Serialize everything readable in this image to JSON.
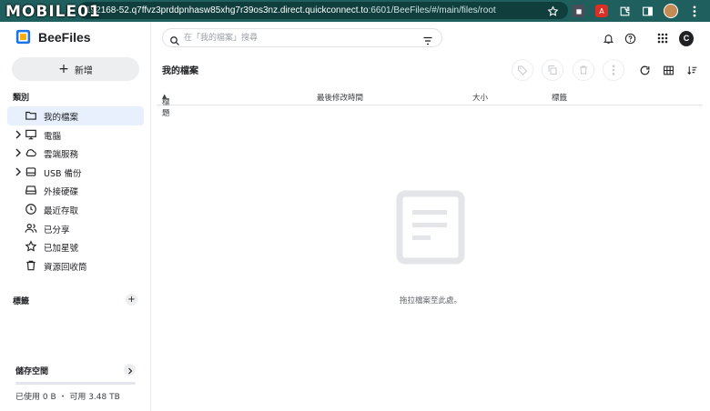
{
  "browser": {
    "watermark": "MOBILE01",
    "url_prefix": "192",
    "url_host": "168-52.q7ffvz3prddpnhasw85xhg7r39os3nz.direct.quickconnect.to",
    "url_path": ":6601/BeeFiles/#/main/files/root"
  },
  "app": {
    "name": "BeeFiles",
    "new_button_label": "新增",
    "accent_color": "#1a73e8"
  },
  "sidebar": {
    "categories_label": "類別",
    "items": [
      {
        "label": "我的檔案",
        "icon": "folder-icon",
        "active": true,
        "expandable": false
      },
      {
        "label": "電腦",
        "icon": "monitor-icon",
        "active": false,
        "expandable": true
      },
      {
        "label": "雲端服務",
        "icon": "cloud-icon",
        "active": false,
        "expandable": true
      },
      {
        "label": "USB 備份",
        "icon": "usb-drive-icon",
        "active": false,
        "expandable": true
      },
      {
        "label": "外接硬碟",
        "icon": "external-drive-icon",
        "active": false,
        "expandable": false
      },
      {
        "label": "最近存取",
        "icon": "clock-icon",
        "active": false,
        "expandable": false
      },
      {
        "label": "已分享",
        "icon": "people-icon",
        "active": false,
        "expandable": false
      },
      {
        "label": "已加星號",
        "icon": "star-icon",
        "active": false,
        "expandable": false
      },
      {
        "label": "資源回收筒",
        "icon": "trash-icon",
        "active": false,
        "expandable": false
      }
    ],
    "tags_label": "標籤",
    "storage": {
      "label": "儲存空間",
      "used_fraction": 0.0,
      "summary": "已使用 0 B ・ 可用 3.48 TB"
    }
  },
  "search": {
    "placeholder": "在「我的檔案」搜尋"
  },
  "main": {
    "title": "我的檔案",
    "columns": [
      "標題",
      "最後修改時間",
      "大小",
      "標籤"
    ],
    "sort_indicator": "^",
    "empty_message": "拖拉檔案至此處。"
  }
}
